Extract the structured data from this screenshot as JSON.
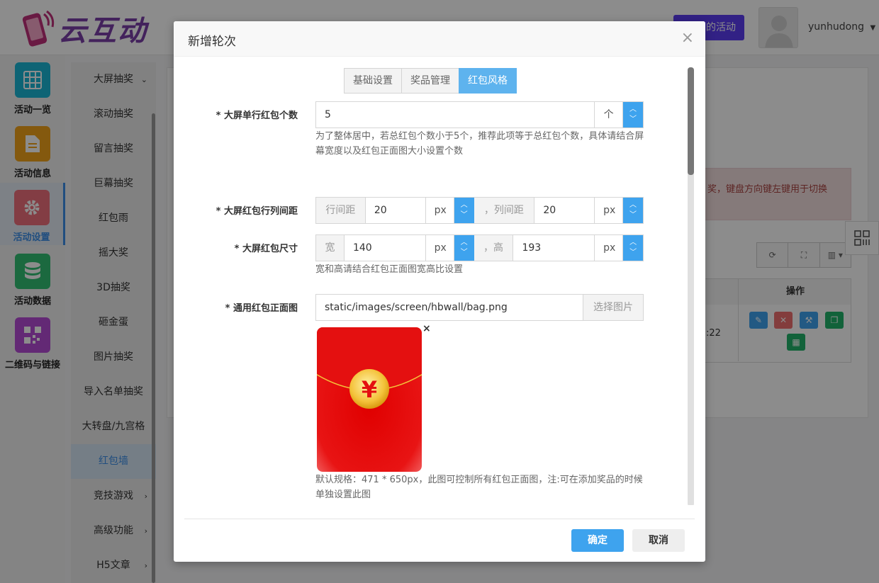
{
  "app": {
    "logo_text": "云互动",
    "my_activities_btn": "的活动",
    "username": "yunhudong"
  },
  "leftnav": [
    {
      "label": "活动一览",
      "color": "#1bb7d6"
    },
    {
      "label": "活动信息",
      "color": "#f0a21a"
    },
    {
      "label": "活动设置",
      "color": "#ee6f7c"
    },
    {
      "label": "活动数据",
      "color": "#32c074"
    },
    {
      "label": "二维码与链接",
      "color": "#b54bd6"
    }
  ],
  "subnav": {
    "header": "大屏抽奖",
    "items": [
      "滚动抽奖",
      "留言抽奖",
      "巨幕抽奖",
      "红包雨",
      "摇大奖",
      "3D抽奖",
      "砸金蛋",
      "图片抽奖",
      "导入名单抽奖",
      "大转盘/九宫格",
      "红包墙",
      "竞技游戏",
      "高级功能",
      "H5文章"
    ]
  },
  "background": {
    "alert_text": "奖，键盘方向键左键用于切换",
    "table_op_header": "操作",
    "row_time": ":22"
  },
  "modal": {
    "title": "新增轮次",
    "close": "×",
    "tabs": [
      "基础设置",
      "奖品管理",
      "红包风格"
    ],
    "active_tab": "红包风格",
    "fields": {
      "per_row": {
        "label": "* 大屏单行红包个数",
        "value": "5",
        "unit": "个",
        "help": "为了整体居中，若总红包个数小于5个，推荐此项等于总红包个数，具体请结合屏幕宽度以及红包正面图大小设置个数"
      },
      "spacing": {
        "label": "* 大屏红包行列间距",
        "row_gap_label": "行间距",
        "row_gap_value": "20",
        "row_gap_unit": "px",
        "col_gap_label": "，列间距",
        "col_gap_value": "20",
        "col_gap_unit": "px"
      },
      "size": {
        "label": "* 大屏红包尺寸",
        "width_label": "宽",
        "width_value": "140",
        "width_unit": "px",
        "height_label": "，高",
        "height_value": "193",
        "height_unit": "px",
        "help": "宽和高请结合红包正面图宽高比设置"
      },
      "front_image": {
        "label": "* 通用红包正面图",
        "path": "static/images/screen/hbwall/bag.png",
        "choose": "选择图片",
        "remove": "×",
        "yuan_symbol": "¥",
        "help": "默认规格：471 * 650px，此图可控制所有红包正面图，注:可在添加奖品的时候单独设置此图"
      }
    },
    "ok": "确定",
    "cancel": "取消"
  },
  "colors": {
    "primary": "#3ea3ee",
    "tab_active": "#5eb3ee",
    "purple_btn": "#5b3df2",
    "envelope_red": "#e60f0f",
    "gold": "#f4c23a"
  }
}
